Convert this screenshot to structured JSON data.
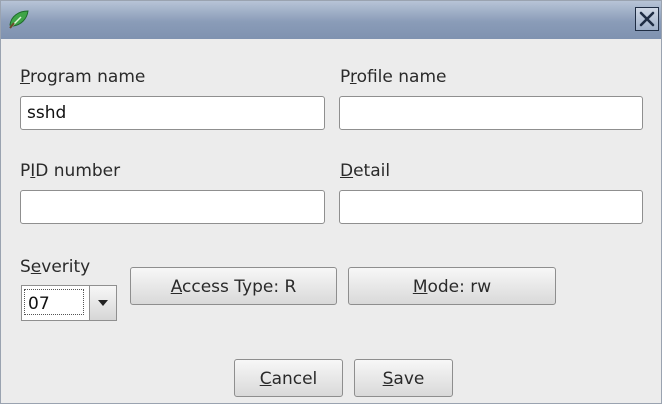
{
  "window": {
    "close_icon": "close-x-icon",
    "app_icon": "green-leaf-icon"
  },
  "fields": {
    "program_name": {
      "label_pre": "",
      "label_mnemonic": "P",
      "label_post": "rogram name",
      "value": "sshd"
    },
    "profile_name": {
      "label_pre": "P",
      "label_mnemonic": "r",
      "label_post": "ofile name",
      "value": ""
    },
    "pid_number": {
      "label_pre": "P",
      "label_mnemonic": "I",
      "label_post": "D number",
      "value": ""
    },
    "detail": {
      "label_pre": "",
      "label_mnemonic": "D",
      "label_post": "etail",
      "value": ""
    }
  },
  "severity": {
    "label_pre": "S",
    "label_mnemonic": "e",
    "label_post": "verity",
    "value": "07"
  },
  "buttons": {
    "access_type": {
      "pre": "",
      "mnemonic": "A",
      "post": "ccess Type: R"
    },
    "mode": {
      "pre": "",
      "mnemonic": "M",
      "post": "ode: rw"
    },
    "cancel": {
      "pre": "",
      "mnemonic": "C",
      "post": "ancel"
    },
    "save": {
      "pre": "",
      "mnemonic": "S",
      "post": "ave"
    }
  }
}
